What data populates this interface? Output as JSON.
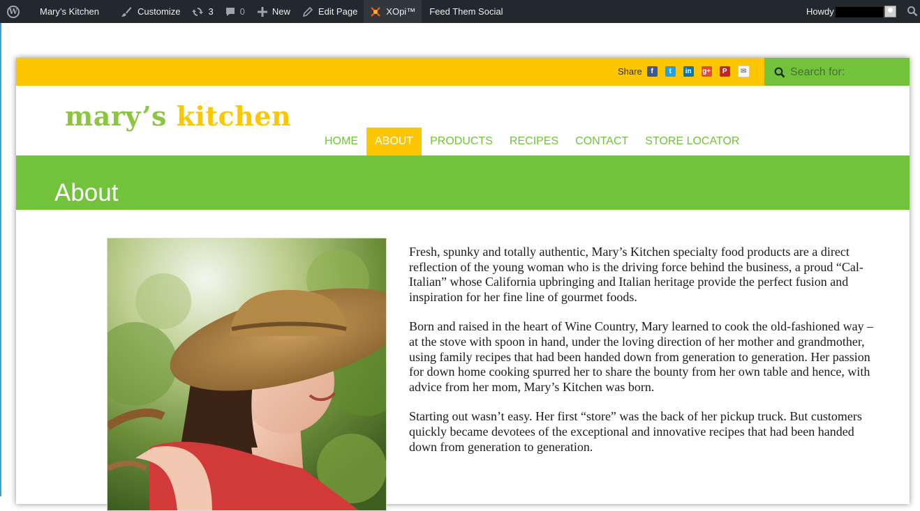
{
  "adminbar": {
    "site_name": "Mary’s Kitchen",
    "customize": "Customize",
    "updates_count": "3",
    "comments_count": "0",
    "new": "New",
    "edit_page": "Edit Page",
    "xopi": "XOpi™",
    "feed_them_social": "Feed Them Social",
    "howdy": "Howdy"
  },
  "topbar": {
    "share_label": "Share",
    "share_icons": [
      "facebook-icon",
      "twitter-icon",
      "linkedin-icon",
      "google-plus-icon",
      "pinterest-icon",
      "email-icon"
    ],
    "search_placeholder": "Search for:"
  },
  "logo": {
    "part1": "mary’s",
    "part2": "kitchen"
  },
  "nav": {
    "items": [
      {
        "label": "HOME"
      },
      {
        "label": "ABOUT",
        "active": true
      },
      {
        "label": "PRODUCTS"
      },
      {
        "label": "RECIPES"
      },
      {
        "label": "CONTACT"
      },
      {
        "label": "STORE LOCATOR"
      }
    ]
  },
  "hero": {
    "title": "About"
  },
  "content": {
    "paragraphs": [
      "Fresh, spunky and totally authentic, Mary’s Kitchen specialty food products are a direct reflection of the young woman who is the driving force behind the business, a proud “Cal-Italian” whose California upbringing and Italian heritage provide the perfect fusion and inspiration for her fine line of gourmet foods.",
      "Born and raised in the heart of Wine Country, Mary learned to cook the old-fashioned way – at the stove with spoon in hand, under the loving direction of her mother and grandmother, using family recipes that had been handed down from generation to generation. Her passion for down home cooking spurred her to share the bounty from her own table and hence, with advice from her mom, Mary’s Kitchen was born.",
      "Starting out wasn’t easy. Her first “store” was the back of her pickup truck. But customers quickly became devotees of the exceptional and innovative recipes that had been handed down from generation to generation."
    ]
  },
  "colors": {
    "admin_bar": "#23282d",
    "yellow": "#fcc600",
    "green": "#73c23b",
    "logo_green": "#8cc63f"
  }
}
